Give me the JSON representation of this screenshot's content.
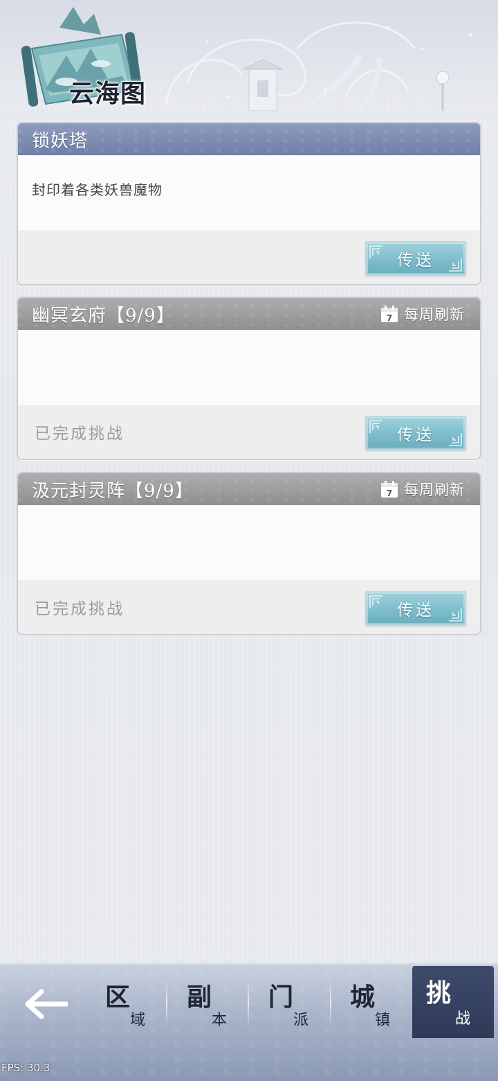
{
  "header": {
    "title": "云海图"
  },
  "cards": [
    {
      "title": "锁妖塔",
      "description": "封印着各类妖兽魔物",
      "status": "",
      "refresh_label": "",
      "teleport_label": "传送"
    },
    {
      "title": "幽冥玄府【9/9】",
      "description": "",
      "status": "已完成挑战",
      "refresh_icon_day": "7",
      "refresh_label": "每周刷新",
      "teleport_label": "传送"
    },
    {
      "title": "汲元封灵阵【9/9】",
      "description": "",
      "status": "已完成挑战",
      "refresh_icon_day": "7",
      "refresh_label": "每周刷新",
      "teleport_label": "传送"
    }
  ],
  "nav": {
    "tabs": [
      {
        "big": "区",
        "small": "域"
      },
      {
        "big": "副",
        "small": "本"
      },
      {
        "big": "门",
        "small": "派"
      },
      {
        "big": "城",
        "small": "镇"
      },
      {
        "big": "挑",
        "small": "战"
      }
    ],
    "active_tab": "挑战"
  },
  "fps": "FPS: 30.3",
  "colors": {
    "active_header": "#7a89ae",
    "inactive_header": "#9a9a9a",
    "teleport_button": "#86c3d0",
    "active_nav_tab": "#343f5f"
  }
}
